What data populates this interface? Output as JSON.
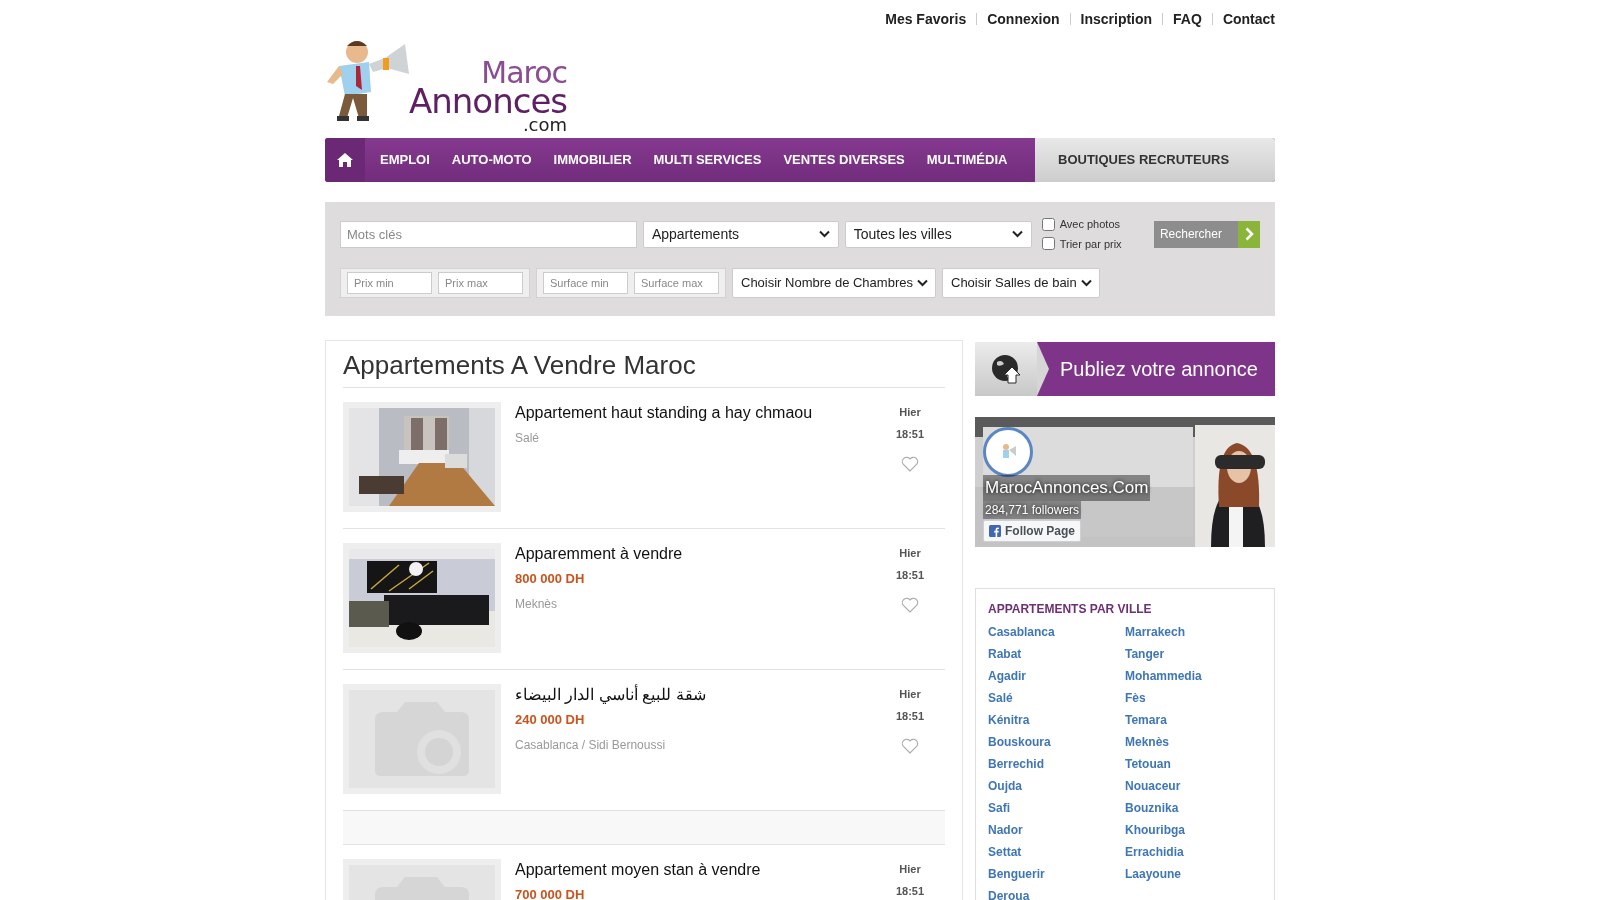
{
  "top_links": [
    "Mes Favoris",
    "Connexion",
    "Inscription",
    "FAQ",
    "Contact"
  ],
  "logo": {
    "line1": "Maroc",
    "line2": "Annonces",
    "line3": ".com"
  },
  "nav": {
    "items": [
      "EMPLOI",
      "AUTO-MOTO",
      "IMMOBILIER",
      "MULTI SERVICES",
      "VENTES DIVERSES",
      "MULTIMÉDIA"
    ],
    "side_link": "BOUTIQUES RECRUTEURS"
  },
  "search": {
    "keywords": {
      "placeholder": "Mots clés"
    },
    "category": "Appartements",
    "city": "Toutes les villes",
    "options": [
      {
        "label": "Avec photos",
        "checked": false
      },
      {
        "label": "Trier par prix",
        "checked": false
      }
    ],
    "button": "Rechercher",
    "price_min": {
      "placeholder": "Prix min"
    },
    "price_max": {
      "placeholder": "Prix max"
    },
    "surface_min": {
      "placeholder": "Surface min"
    },
    "surface_max": {
      "placeholder": "Surface max"
    },
    "rooms": "Choisir Nombre de Chambres",
    "bathrooms": "Choisir Salles de bain"
  },
  "listing": {
    "title": "Appartements A Vendre Maroc",
    "items": [
      {
        "kind": "picture",
        "title": "Appartement haut standing a hay chmaou",
        "location": "Salé",
        "day": "Hier",
        "time": "18:51",
        "favorite_icon": true
      },
      {
        "kind": "picture",
        "title": "Apparemment à vendre",
        "price": "800 000 DH",
        "location": "Meknès",
        "day": "Hier",
        "time": "18:51",
        "favorite_icon": true
      },
      {
        "kind": "placeholder",
        "title": "شقة للبيع أناسي الدار البيضاء",
        "price": "240 000 DH",
        "location": "Casablanca / Sidi Bernoussi",
        "day": "Hier",
        "time": "18:51",
        "favorite_icon": true
      },
      {
        "kind": "banner"
      },
      {
        "kind": "placeholder",
        "title": "Appartement moyen stan à vendre",
        "price": "700 000 DH",
        "day": "Hier",
        "time": "18:51"
      }
    ]
  },
  "publish_button": "Publiez votre annonce",
  "facebook": {
    "page_name": "MarocAnnonces.Com",
    "followers": "284,771 followers",
    "follow_button": "Follow Page"
  },
  "cities": {
    "title": "APPARTEMENTS PAR VILLE",
    "items": [
      "Casablanca",
      "Marrakech",
      "Rabat",
      "Tanger",
      "Agadir",
      "Mohammedia",
      "Salé",
      "Fès",
      "Kénitra",
      "Temara",
      "Bouskoura",
      "Meknès",
      "Berrechid",
      "Tetouan",
      "Oujda",
      "Nouaceur",
      "Safi",
      "Bouznika",
      "Nador",
      "Khouribga",
      "Settat",
      "Errachidia",
      "Benguerir",
      "Laayoune",
      "Deroua"
    ]
  }
}
